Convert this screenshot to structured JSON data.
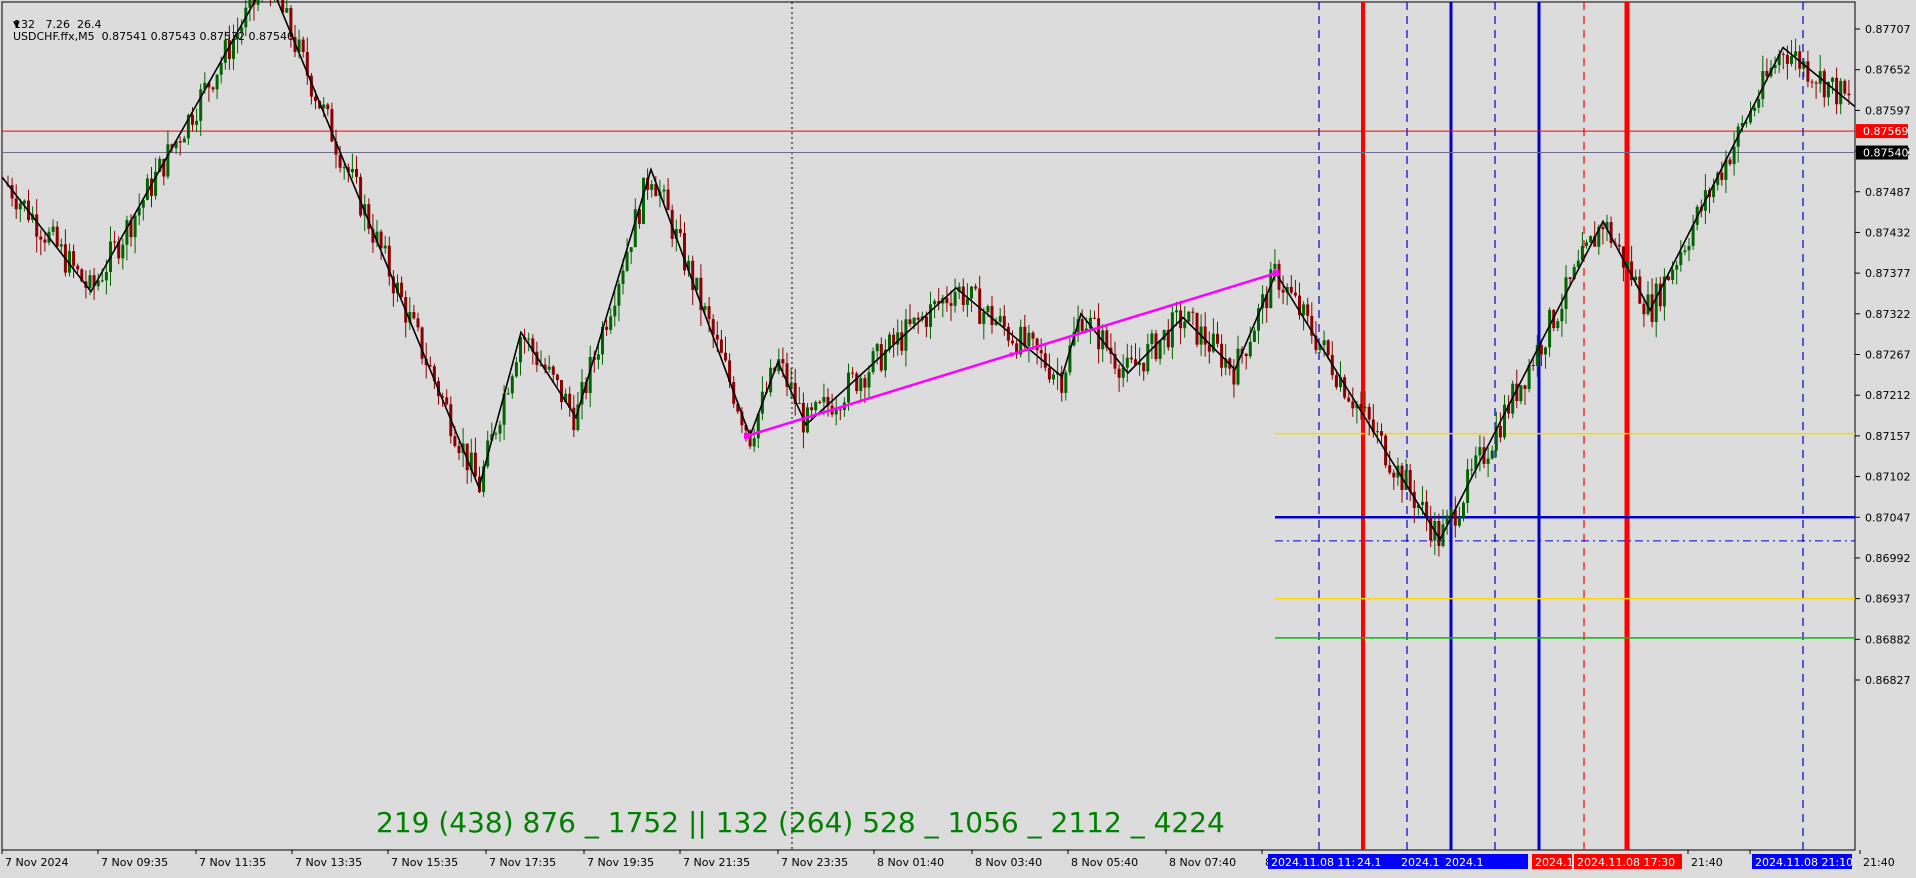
{
  "header": {
    "symbol_line": "USDCHF.ffx,M5  0.87541 0.87543 0.87532 0.87540",
    "stats_line": "132   7.26  26.4"
  },
  "footer_text": "219 (438) 876 _ 1752 || 132 (264) 528 _ 1056 _ 2112 _ 4224",
  "colors": {
    "background": "#dcdcdc",
    "candle_bull": "#006400",
    "candle_bear": "#8b0000",
    "zigzag": "#000000",
    "channel": "#ff00ff",
    "red_line": "#ff0000",
    "blue_line": "#0000cd",
    "yellow_line": "#ffd700",
    "green_line": "#00c000",
    "text_green": "#008000"
  },
  "chart_data": {
    "type": "candlestick",
    "title": "USDCHF.ffx,M5",
    "ylim": [
      0.868,
      0.8776
    ],
    "y_ticks": [
      "0.87707",
      "0.87652",
      "0.87597",
      "0.87542",
      "0.87487",
      "0.87432",
      "0.87377",
      "0.87322",
      "0.87267",
      "0.87212",
      "0.87157",
      "0.87102",
      "0.87047",
      "0.86992",
      "0.86937",
      "0.86882",
      "0.86827"
    ],
    "x_ticks": [
      "7 Nov 2024",
      "7 Nov 09:35",
      "7 Nov 11:35",
      "7 Nov 13:35",
      "7 Nov 15:35",
      "7 Nov 17:35",
      "7 Nov 19:35",
      "7 Nov 21:35",
      "7 Nov 23:35",
      "8 Nov 01:40",
      "8 Nov 03:40",
      "8 Nov 05:40",
      "8 Nov 07:40",
      "8 N",
      "21:40",
      "8 N",
      "21:40"
    ],
    "price_labels": [
      {
        "value": "0.87569",
        "color": "#ff0000"
      },
      {
        "value": "0.87540",
        "color": "#000000"
      }
    ],
    "time_labels": [
      {
        "text": "2024.11.08 11:05",
        "color": "#0000ff"
      },
      {
        "text": "24.1",
        "color": "#0000ff"
      },
      {
        "text": "2024.1",
        "color": "#0000ff"
      },
      {
        "text": "2024.1",
        "color": "#0000ff"
      },
      {
        "text": "2024.1",
        "color": "#ff0000"
      },
      {
        "text": "2024.11.08 17:30",
        "color": "#ff0000"
      },
      {
        "text": "2024.11.08 21:10",
        "color": "#0000ff"
      }
    ],
    "zigzag": [
      0.87507,
      0.87352,
      0.87776,
      0.87087,
      0.87297,
      0.87182,
      0.87517,
      0.87157,
      0.87257,
      0.87172,
      0.87357,
      0.87237,
      0.87322,
      0.87242,
      0.87317,
      0.87247,
      0.87377,
      0.87017,
      0.87447,
      0.87327,
      0.87682,
      0.87602
    ],
    "channel": [
      0.87157,
      0.87377
    ],
    "hlines": [
      {
        "value": 0.87569,
        "color": "#ff0000",
        "style": "thin"
      },
      {
        "value": 0.8754,
        "color": "#6e6e8c",
        "style": "thin"
      },
      {
        "value": 0.8716,
        "color": "#ffd700",
        "style": "segment"
      },
      {
        "value": 0.87047,
        "color": "#0000cd",
        "style": "segment-thick"
      },
      {
        "value": 0.87015,
        "color": "#0000cd",
        "style": "segment-dashdot"
      },
      {
        "value": 0.86937,
        "color": "#ffd700",
        "style": "segment"
      },
      {
        "value": 0.86884,
        "color": "#00c000",
        "style": "segment"
      }
    ]
  }
}
